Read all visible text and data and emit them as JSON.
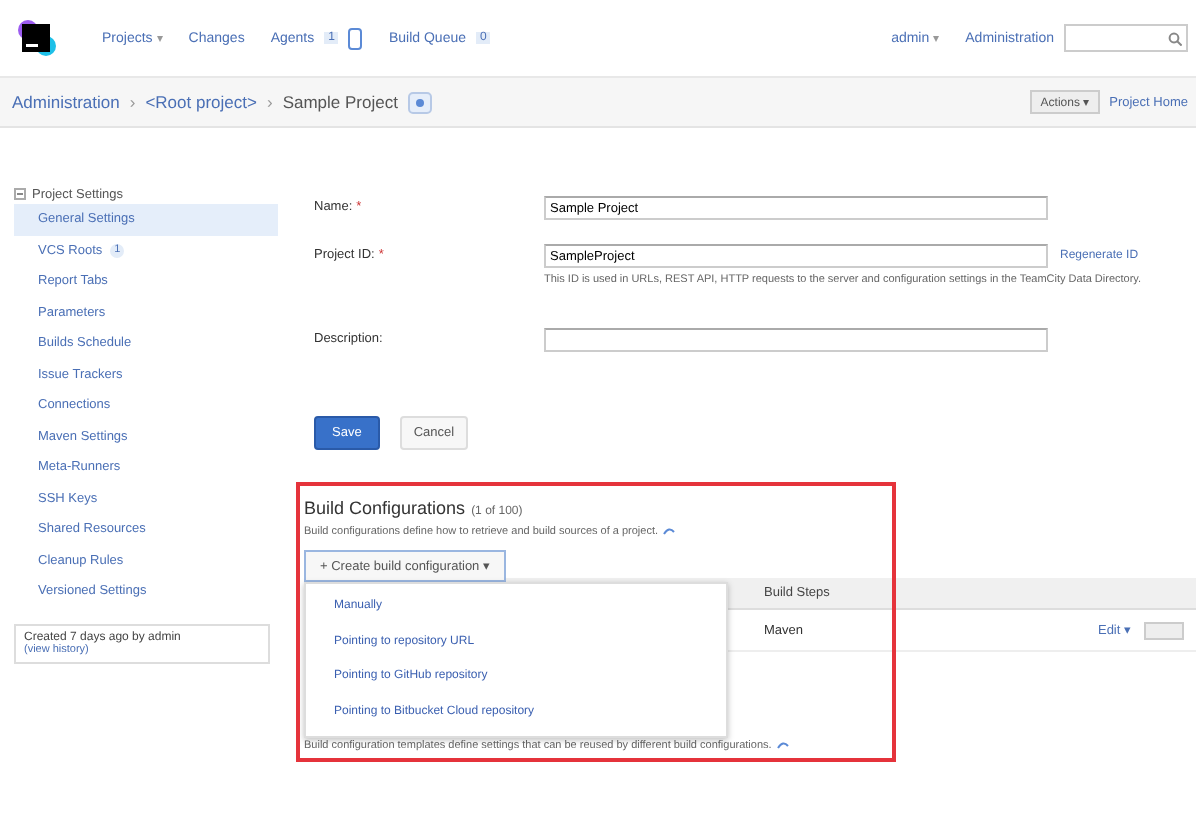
{
  "header": {
    "nav": [
      {
        "label": "Projects",
        "caret": "▾"
      },
      {
        "label": "Changes"
      },
      {
        "label": "Agents",
        "badge": "1"
      },
      {
        "label": "Build Queue",
        "badge": "0"
      }
    ],
    "user": "admin",
    "user_caret": "▾",
    "admin_link": "Administration"
  },
  "breadcrumb": {
    "items": [
      "Administration",
      "<Root project>",
      "Sample Project"
    ],
    "separator": "›",
    "actions": "Actions ▾",
    "home_link": "Project Home"
  },
  "sidebar": {
    "heading": "Project Settings",
    "items": [
      {
        "label": "General Settings",
        "selected": true
      },
      {
        "label": "VCS Roots",
        "selected": false,
        "badge": "1"
      },
      {
        "label": "Report Tabs",
        "selected": false
      },
      {
        "label": "Parameters",
        "selected": false
      },
      {
        "label": "Builds Schedule",
        "selected": false
      },
      {
        "label": "Issue Trackers",
        "selected": false
      },
      {
        "label": "Connections",
        "selected": false
      },
      {
        "label": "Maven Settings",
        "selected": false
      },
      {
        "label": "Meta-Runners",
        "selected": false
      },
      {
        "label": "SSH Keys",
        "selected": false
      },
      {
        "label": "Shared Resources",
        "selected": false
      },
      {
        "label": "Cleanup Rules",
        "selected": false
      },
      {
        "label": "Versioned Settings",
        "selected": false
      }
    ],
    "created": "Created 7 days ago by admin",
    "history_link": "(view history)"
  },
  "form": {
    "fields": [
      {
        "label": "Name:",
        "required_mark": "*",
        "value": "Sample Project"
      },
      {
        "label": "Project ID:",
        "required_mark": "*",
        "value": "SampleProject",
        "link": "Regenerate ID",
        "note": "This ID is used in URLs, REST API, HTTP requests to the server and configuration settings in the TeamCity Data Directory."
      },
      {
        "label": "Description:"
      }
    ],
    "save": "Save",
    "cancel": "Cancel"
  },
  "build_configurations": {
    "title": "Build Configurations",
    "count": "(1 of 100)",
    "description": "Build configurations define how to retrieve and build sources of a project.",
    "create_button": "+ Create build configuration ▾",
    "menu": [
      "Manually",
      "Pointing to repository URL",
      "Pointing to GitHub repository",
      "Pointing to Bitbucket Cloud repository"
    ],
    "column": "Build Steps",
    "row_steps": "Maven",
    "edit": "Edit ▾"
  },
  "templates_description": "Build configuration templates define settings that can be reused by different build configurations."
}
